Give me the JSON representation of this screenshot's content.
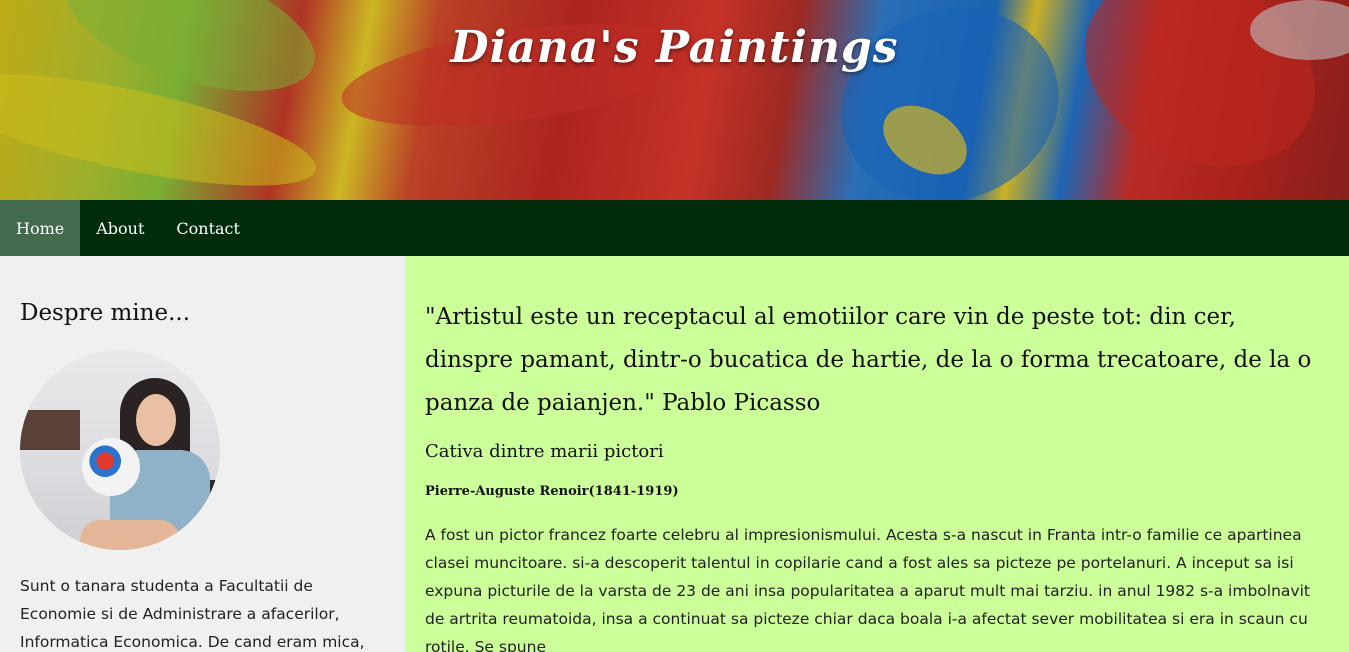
{
  "header": {
    "title": "Diana's Paintings"
  },
  "nav": {
    "items": [
      {
        "label": "Home",
        "active": true
      },
      {
        "label": "About",
        "active": false
      },
      {
        "label": "Contact",
        "active": false
      }
    ]
  },
  "sidebar": {
    "heading": "Despre mine...",
    "bio": "Sunt o tanara studenta a Facultatii de Economie si de Administrare a afacerilor, Informatica Economica. De cand eram mica, cea mai mare"
  },
  "main": {
    "quote": "\"Artistul este un receptacul al emotiilor care vin de peste tot: din cer, dinspre pamant, dintr-o bucatica de hartie, de la o forma trecatoare, de la o panza de paianjen.\" Pablo Picasso",
    "section_title": "Cativa dintre marii pictori",
    "painter_name": "Pierre-Auguste Renoir(1841-1919)",
    "painter_text": "A fost un pictor francez foarte celebru al impresionismului. Acesta s-a nascut in Franta intr-o familie ce apartinea clasei muncitoare. si-a descoperit talentul in copilarie cand a fost ales sa picteze pe portelanuri. A inceput sa isi expuna picturile de la varsta de 23 de ani insa popularitatea a aparut mult mai tarziu. in anul 1982 s-a imbolnavit de artrita reumatoida, insa a continuat sa picteze chiar daca boala i-a afectat sever mobilitatea si era in scaun cu rotile. Se spune"
  },
  "colors": {
    "nav_bg": "#002c0c",
    "nav_active": "#446a4e",
    "main_bg": "#ccff99",
    "sidebar_bg": "#f1f0f1"
  }
}
